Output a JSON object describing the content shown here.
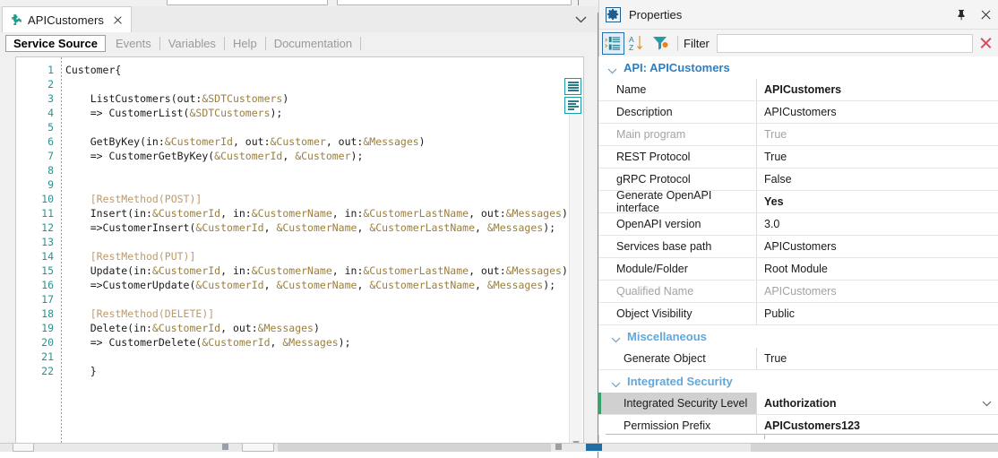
{
  "document_tab": {
    "title": "APICustomers",
    "icon": "puzzle-piece-icon",
    "close_icon": "close-icon",
    "overflow_icon": "chevron-down-icon"
  },
  "view_tabs": [
    {
      "label": "Service Source",
      "active": true
    },
    {
      "label": "Events",
      "active": false
    },
    {
      "label": "Variables",
      "active": false
    },
    {
      "label": "Help",
      "active": false
    },
    {
      "label": "Documentation",
      "active": false
    }
  ],
  "editor": {
    "line_numbers": [
      "1",
      "2",
      "3",
      "4",
      "5",
      "6",
      "7",
      "8",
      "9",
      "10",
      "11",
      "12",
      "13",
      "14",
      "15",
      "16",
      "17",
      "18",
      "19",
      "20",
      "21",
      "22"
    ],
    "lines": [
      {
        "n": 1,
        "segments": [
          {
            "t": "Customer{",
            "c": "plain"
          }
        ]
      },
      {
        "n": 2,
        "segments": [
          {
            "t": "",
            "c": "plain"
          }
        ]
      },
      {
        "n": 3,
        "segments": [
          {
            "t": "    ListCustomers(out:",
            "c": "plain"
          },
          {
            "t": "&SDTCustomers",
            "c": "var"
          },
          {
            "t": ")",
            "c": "plain"
          }
        ]
      },
      {
        "n": 4,
        "segments": [
          {
            "t": "    => CustomerList(",
            "c": "plain"
          },
          {
            "t": "&SDTCustomers",
            "c": "var"
          },
          {
            "t": ");",
            "c": "plain"
          }
        ]
      },
      {
        "n": 5,
        "segments": [
          {
            "t": "",
            "c": "plain"
          }
        ]
      },
      {
        "n": 6,
        "segments": [
          {
            "t": "    GetByKey(in:",
            "c": "plain"
          },
          {
            "t": "&CustomerId",
            "c": "var"
          },
          {
            "t": ", out:",
            "c": "plain"
          },
          {
            "t": "&Customer",
            "c": "var"
          },
          {
            "t": ", out:",
            "c": "plain"
          },
          {
            "t": "&Messages",
            "c": "var"
          },
          {
            "t": ")",
            "c": "plain"
          }
        ]
      },
      {
        "n": 7,
        "segments": [
          {
            "t": "    => CustomerGetByKey(",
            "c": "plain"
          },
          {
            "t": "&CustomerId",
            "c": "var"
          },
          {
            "t": ", ",
            "c": "plain"
          },
          {
            "t": "&Customer",
            "c": "var"
          },
          {
            "t": ");",
            "c": "plain"
          }
        ]
      },
      {
        "n": 8,
        "segments": [
          {
            "t": "",
            "c": "plain"
          }
        ]
      },
      {
        "n": 9,
        "segments": [
          {
            "t": "",
            "c": "plain"
          }
        ]
      },
      {
        "n": 10,
        "segments": [
          {
            "t": "    [RestMethod(POST)]",
            "c": "attr"
          }
        ]
      },
      {
        "n": 11,
        "segments": [
          {
            "t": "    Insert(in:",
            "c": "plain"
          },
          {
            "t": "&CustomerId",
            "c": "var"
          },
          {
            "t": ", in:",
            "c": "plain"
          },
          {
            "t": "&CustomerName",
            "c": "var"
          },
          {
            "t": ", in:",
            "c": "plain"
          },
          {
            "t": "&CustomerLastName",
            "c": "var"
          },
          {
            "t": ", out:",
            "c": "plain"
          },
          {
            "t": "&Messages",
            "c": "var"
          },
          {
            "t": ")",
            "c": "plain"
          }
        ]
      },
      {
        "n": 12,
        "segments": [
          {
            "t": "    =>CustomerInsert(",
            "c": "plain"
          },
          {
            "t": "&CustomerId",
            "c": "var"
          },
          {
            "t": ", ",
            "c": "plain"
          },
          {
            "t": "&CustomerName",
            "c": "var"
          },
          {
            "t": ", ",
            "c": "plain"
          },
          {
            "t": "&CustomerLastName",
            "c": "var"
          },
          {
            "t": ", ",
            "c": "plain"
          },
          {
            "t": "&Messages",
            "c": "var"
          },
          {
            "t": ");",
            "c": "plain"
          }
        ]
      },
      {
        "n": 13,
        "segments": [
          {
            "t": "",
            "c": "plain"
          }
        ]
      },
      {
        "n": 14,
        "segments": [
          {
            "t": "    [RestMethod(PUT)]",
            "c": "attr"
          }
        ]
      },
      {
        "n": 15,
        "segments": [
          {
            "t": "    Update(in:",
            "c": "plain"
          },
          {
            "t": "&CustomerId",
            "c": "var"
          },
          {
            "t": ", in:",
            "c": "plain"
          },
          {
            "t": "&CustomerName",
            "c": "var"
          },
          {
            "t": ", in:",
            "c": "plain"
          },
          {
            "t": "&CustomerLastName",
            "c": "var"
          },
          {
            "t": ", out:",
            "c": "plain"
          },
          {
            "t": "&Messages",
            "c": "var"
          },
          {
            "t": ")",
            "c": "plain"
          }
        ]
      },
      {
        "n": 16,
        "segments": [
          {
            "t": "    =>CustomerUpdate(",
            "c": "plain"
          },
          {
            "t": "&CustomerId",
            "c": "var"
          },
          {
            "t": ", ",
            "c": "plain"
          },
          {
            "t": "&CustomerName",
            "c": "var"
          },
          {
            "t": ", ",
            "c": "plain"
          },
          {
            "t": "&CustomerLastName",
            "c": "var"
          },
          {
            "t": ", ",
            "c": "plain"
          },
          {
            "t": "&Messages",
            "c": "var"
          },
          {
            "t": ");",
            "c": "plain"
          }
        ]
      },
      {
        "n": 17,
        "segments": [
          {
            "t": "",
            "c": "plain"
          }
        ]
      },
      {
        "n": 18,
        "segments": [
          {
            "t": "    [RestMethod(DELETE)]",
            "c": "attr"
          }
        ]
      },
      {
        "n": 19,
        "segments": [
          {
            "t": "    Delete(in:",
            "c": "plain"
          },
          {
            "t": "&CustomerId",
            "c": "var"
          },
          {
            "t": ", out:",
            "c": "plain"
          },
          {
            "t": "&Messages",
            "c": "var"
          },
          {
            "t": ")",
            "c": "plain"
          }
        ]
      },
      {
        "n": 20,
        "segments": [
          {
            "t": "    => CustomerDelete(",
            "c": "plain"
          },
          {
            "t": "&CustomerId",
            "c": "var"
          },
          {
            "t": ", ",
            "c": "plain"
          },
          {
            "t": "&Messages",
            "c": "var"
          },
          {
            "t": ");",
            "c": "plain"
          }
        ]
      },
      {
        "n": 21,
        "segments": [
          {
            "t": "",
            "c": "plain"
          }
        ]
      },
      {
        "n": 22,
        "segments": [
          {
            "t": "    }",
            "c": "plain"
          }
        ]
      }
    ],
    "outline_buttons": [
      "expand-all-icon",
      "collapse-all-icon"
    ],
    "scroll_up_icon": "scroll-up-arrow-icon",
    "scroll_down_icon": "scroll-down-arrow-icon"
  },
  "properties": {
    "title": "Properties",
    "title_icon": "gear-icon",
    "pin_icon": "pin-icon",
    "close_icon": "close-icon",
    "toolbar": {
      "categorized_icon": "categorized-list-icon",
      "alphabetical_icon": "sort-alphabetical-icon",
      "filter_toggle_icon": "filter-funnel-icon",
      "filter_label": "Filter",
      "filter_value": "",
      "filter_placeholder": "",
      "clear_icon": "clear-filter-icon"
    },
    "groups": [
      {
        "label": "API: APICustomers",
        "level": "main",
        "collapse_icon": "chevron-down-icon",
        "rows": [
          {
            "key": "Name",
            "value": "APICustomers",
            "bold": true,
            "dim": false,
            "selected": false,
            "dropdown": false
          },
          {
            "key": "Description",
            "value": "APICustomers",
            "bold": false,
            "dim": false,
            "selected": false,
            "dropdown": false
          },
          {
            "key": "Main program",
            "value": "True",
            "bold": false,
            "dim": true,
            "selected": false,
            "dropdown": false
          },
          {
            "key": "REST Protocol",
            "value": "True",
            "bold": false,
            "dim": false,
            "selected": false,
            "dropdown": false
          },
          {
            "key": "gRPC Protocol",
            "value": "False",
            "bold": false,
            "dim": false,
            "selected": false,
            "dropdown": false
          },
          {
            "key": "Generate OpenAPI interface",
            "value": "Yes",
            "bold": true,
            "dim": false,
            "selected": false,
            "dropdown": false
          },
          {
            "key": "OpenAPI version",
            "value": "3.0",
            "bold": false,
            "dim": false,
            "selected": false,
            "dropdown": false
          },
          {
            "key": "Services base path",
            "value": "APICustomers",
            "bold": false,
            "dim": false,
            "selected": false,
            "dropdown": false
          },
          {
            "key": "Module/Folder",
            "value": "Root Module",
            "bold": false,
            "dim": false,
            "selected": false,
            "dropdown": false
          },
          {
            "key": "Qualified Name",
            "value": "APICustomers",
            "bold": false,
            "dim": true,
            "selected": false,
            "dropdown": false
          },
          {
            "key": "Object Visibility",
            "value": "Public",
            "bold": false,
            "dim": false,
            "selected": false,
            "dropdown": false
          }
        ]
      },
      {
        "label": "Miscellaneous",
        "level": "sub",
        "collapse_icon": "chevron-down-icon",
        "rows": [
          {
            "key": "Generate Object",
            "value": "True",
            "bold": false,
            "dim": false,
            "selected": false,
            "dropdown": false
          }
        ]
      },
      {
        "label": "Integrated Security",
        "level": "sub",
        "collapse_icon": "chevron-down-icon",
        "rows": [
          {
            "key": "Integrated Security Level",
            "value": "Authorization",
            "bold": true,
            "dim": false,
            "selected": true,
            "dropdown": true
          },
          {
            "key": "Permission Prefix",
            "value": "APICustomers123",
            "bold": true,
            "dim": false,
            "selected": false,
            "dropdown": false
          }
        ]
      }
    ]
  },
  "colors": {
    "accent_teal": "#1a9ba8",
    "group_main": "#2b7fc4",
    "group_sub": "#5fa8dd",
    "line_number": "#2f8f8f",
    "code_variable": "#9a8040",
    "code_attribute": "#bd9a6a",
    "selection_marker": "#37a06b",
    "clear_red": "#e0485a"
  }
}
